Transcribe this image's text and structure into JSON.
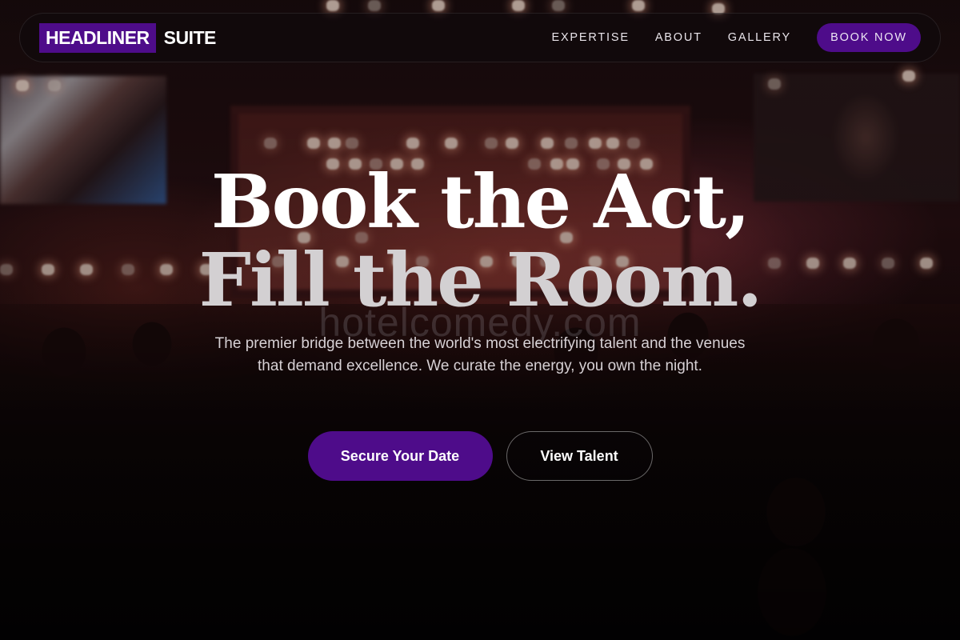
{
  "brand": {
    "logo_primary": "HEADLINER",
    "logo_secondary": "SUITE",
    "accent_color": "#4e0c8a"
  },
  "nav": {
    "links": [
      "EXPERTISE",
      "ABOUT",
      "GALLERY"
    ],
    "cta_label": "BOOK NOW"
  },
  "hero": {
    "headline_line1": "Book the Act,",
    "headline_line2": "Fill the Room.",
    "watermark": "hotelcomedy.com",
    "subtitle": "The premier bridge between the world's most electrifying talent and the venues that demand excellence. We curate the energy, you own the night.",
    "primary_cta": "Secure Your Date",
    "secondary_cta": "View Talent",
    "background_image": "concert-crowd-stage-photo"
  }
}
